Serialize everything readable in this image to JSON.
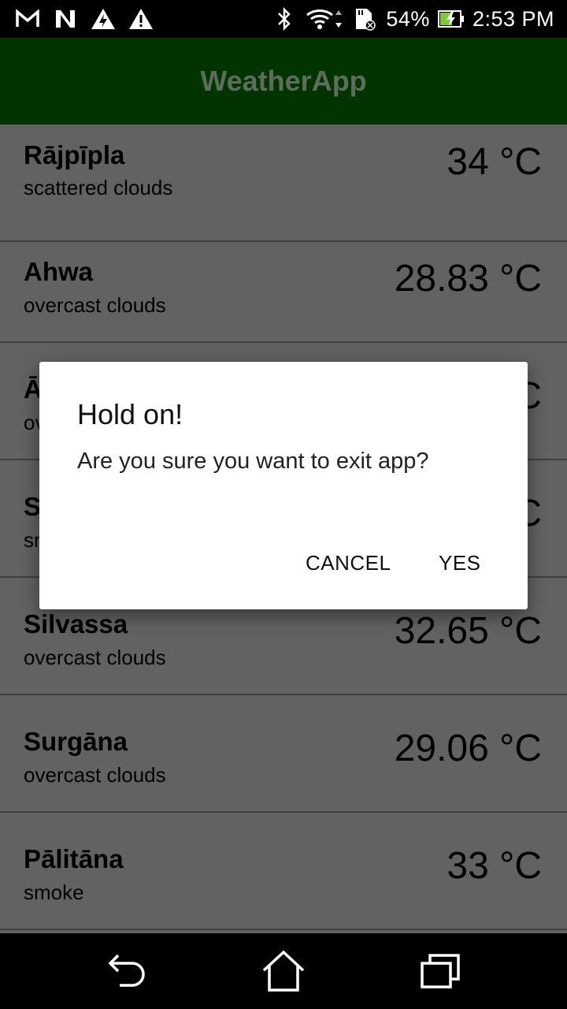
{
  "status_bar": {
    "battery_percent": "54%",
    "time": "2:53 PM",
    "icons_left": [
      "gmail-icon",
      "n-notification-icon",
      "warning-bolt-icon",
      "warning-icon"
    ],
    "icons_right": [
      "bluetooth-icon",
      "wifi-icon",
      "sd-card-icon",
      "battery-charging-icon"
    ]
  },
  "app_bar": {
    "title": "WeatherApp",
    "background_color": "#013401"
  },
  "list": {
    "items": [
      {
        "city": "Rājpīpla",
        "description": "scattered clouds",
        "temperature": "34 °C"
      },
      {
        "city": "Ahwa",
        "description": "overcast clouds",
        "temperature": "28.83 °C"
      },
      {
        "city": "Ā",
        "description": "ov",
        "temperature": "C"
      },
      {
        "city": "S",
        "description": "sn",
        "temperature": "C"
      },
      {
        "city": "Silvassa",
        "description": "overcast clouds",
        "temperature": "32.65 °C"
      },
      {
        "city": "Surgāna",
        "description": "overcast clouds",
        "temperature": "29.06 °C"
      },
      {
        "city": "Pālitāna",
        "description": "smoke",
        "temperature": "33 °C"
      }
    ]
  },
  "dialog": {
    "title": "Hold on!",
    "message": "Are you sure you want to exit app?",
    "cancel_label": "CANCEL",
    "yes_label": "YES"
  },
  "nav_bar": {
    "icons": [
      "back-icon",
      "home-icon",
      "recent-apps-icon"
    ]
  }
}
